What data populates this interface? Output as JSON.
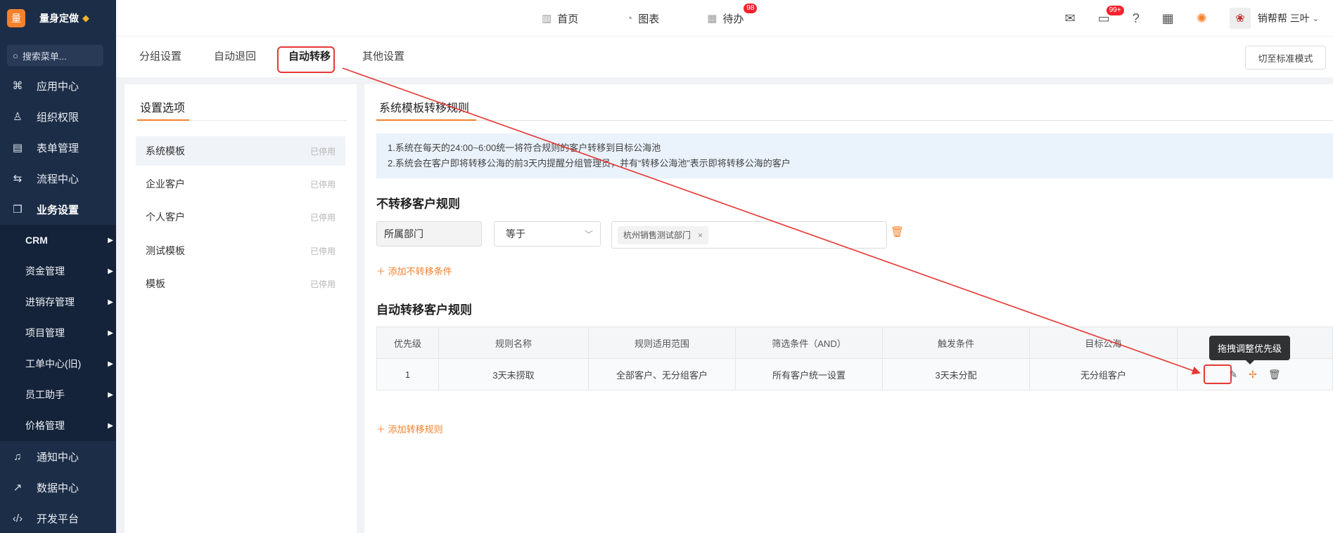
{
  "app": {
    "logo_char": "量",
    "name": "量身定做"
  },
  "sidebar": {
    "search_placeholder": "搜索菜单...",
    "items": [
      {
        "label": "应用中心",
        "icon": "apps-icon"
      },
      {
        "label": "组织权限",
        "icon": "user-icon"
      },
      {
        "label": "表单管理",
        "icon": "form-icon"
      },
      {
        "label": "流程中心",
        "icon": "flow-icon"
      },
      {
        "label": "业务设置",
        "icon": "cube-icon"
      }
    ],
    "sub_items": [
      "CRM",
      "资金管理",
      "进销存管理",
      "项目管理",
      "工单中心(旧)",
      "员工助手",
      "价格管理"
    ],
    "bottom_items": [
      {
        "label": "通知中心",
        "icon": "bell-icon"
      },
      {
        "label": "数据中心",
        "icon": "chart-icon"
      },
      {
        "label": "开发平台",
        "icon": "code-icon"
      }
    ]
  },
  "topbar": {
    "nav": [
      {
        "label": "首页",
        "icon": "home-icon"
      },
      {
        "label": "图表",
        "icon": "chart-icon"
      },
      {
        "label": "待办",
        "icon": "calendar-icon",
        "badge": "98"
      }
    ],
    "message_badge": "99+",
    "user_name": "销帮帮 三叶"
  },
  "tabs": [
    "分组设置",
    "自动退回",
    "自动转移",
    "其他设置"
  ],
  "active_tab": "自动转移",
  "switch_mode_label": "切至标准模式",
  "settings_panel": {
    "title": "设置选项",
    "options": [
      {
        "name": "系统模板",
        "state": "已停用"
      },
      {
        "name": "企业客户",
        "state": "已停用"
      },
      {
        "name": "个人客户",
        "state": "已停用"
      },
      {
        "name": "测试模板",
        "state": "已停用"
      },
      {
        "name": "模板",
        "state": "已停用"
      }
    ]
  },
  "rules_panel": {
    "title": "系统模板转移规则",
    "notice": [
      "1.系统在每天的24:00~6:00统一将符合规则的客户转移到目标公海池",
      "2.系统会在客户即将转移公海的前3天内提醒分组管理员，并有“转移公海池”表示即将转移公海的客户"
    ],
    "no_transfer_title": "不转移客户规则",
    "condition": {
      "field": "所属部门",
      "operator": "等于",
      "tag": "杭州销售测试部门"
    },
    "add_no_transfer": "添加不转移条件",
    "auto_transfer_title": "自动转移客户规则",
    "table": {
      "headers": [
        "优先级",
        "规则名称",
        "规则适用范围",
        "筛选条件（AND）",
        "触发条件",
        "目标公海",
        ""
      ],
      "rows": [
        [
          "1",
          "3天未捞取",
          "全部客户、无分组客户",
          "所有客户统一设置",
          "3天未分配",
          "无分组客户"
        ]
      ]
    },
    "add_rule": "添加转移规则",
    "tooltip": "拖拽调整优先级"
  },
  "colors": {
    "accent": "#f5812b",
    "sidebar": "#1c2d47",
    "annotation": "#e53935"
  }
}
